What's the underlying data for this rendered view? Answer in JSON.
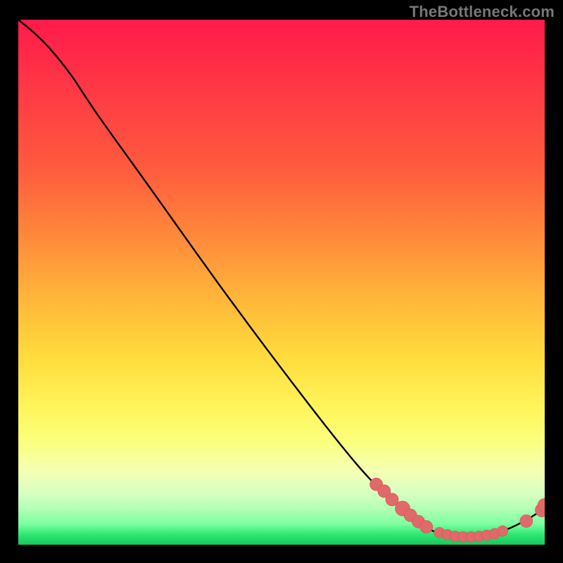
{
  "watermark": "TheBottleneck.com",
  "colors": {
    "curve": "#000000",
    "dot_fill": "#e06a6a",
    "dot_stroke": "#d45858",
    "background": "#000000"
  },
  "chart_data": {
    "type": "line",
    "title": "",
    "xlabel": "",
    "ylabel": "",
    "xlim": [
      0,
      100
    ],
    "ylim": [
      0,
      100
    ],
    "grid": false,
    "curve": [
      {
        "x": 0,
        "y": 100
      },
      {
        "x": 3,
        "y": 97.5
      },
      {
        "x": 6,
        "y": 94.5
      },
      {
        "x": 10,
        "y": 89.5
      },
      {
        "x": 15,
        "y": 82.0
      },
      {
        "x": 25,
        "y": 68.0
      },
      {
        "x": 40,
        "y": 47.0
      },
      {
        "x": 55,
        "y": 27.0
      },
      {
        "x": 65,
        "y": 14.5
      },
      {
        "x": 72,
        "y": 7.5
      },
      {
        "x": 78,
        "y": 3.0
      },
      {
        "x": 83,
        "y": 1.5
      },
      {
        "x": 88,
        "y": 1.5
      },
      {
        "x": 93,
        "y": 3.0
      },
      {
        "x": 97,
        "y": 5.0
      },
      {
        "x": 100,
        "y": 7.0
      }
    ],
    "points": [
      {
        "x": 68,
        "y": 11.5,
        "r": 1.2
      },
      {
        "x": 69.5,
        "y": 10.2,
        "r": 1.2
      },
      {
        "x": 71,
        "y": 8.6,
        "r": 1.2
      },
      {
        "x": 73,
        "y": 6.9,
        "r": 1.4
      },
      {
        "x": 74.5,
        "y": 5.6,
        "r": 1.2
      },
      {
        "x": 76,
        "y": 4.4,
        "r": 1.2
      },
      {
        "x": 77.5,
        "y": 3.4,
        "r": 1.2
      },
      {
        "x": 80,
        "y": 2.3,
        "r": 1.0
      },
      {
        "x": 81.5,
        "y": 1.9,
        "r": 1.0
      },
      {
        "x": 83,
        "y": 1.6,
        "r": 1.0
      },
      {
        "x": 84.5,
        "y": 1.5,
        "r": 1.0
      },
      {
        "x": 86,
        "y": 1.5,
        "r": 1.0
      },
      {
        "x": 87.5,
        "y": 1.6,
        "r": 1.0
      },
      {
        "x": 89,
        "y": 1.8,
        "r": 1.0
      },
      {
        "x": 90.5,
        "y": 2.1,
        "r": 1.0
      },
      {
        "x": 92,
        "y": 2.6,
        "r": 1.0
      },
      {
        "x": 96.5,
        "y": 4.5,
        "r": 1.2
      },
      {
        "x": 99.5,
        "y": 6.6,
        "r": 1.3
      },
      {
        "x": 100,
        "y": 7.5,
        "r": 1.3
      }
    ]
  }
}
